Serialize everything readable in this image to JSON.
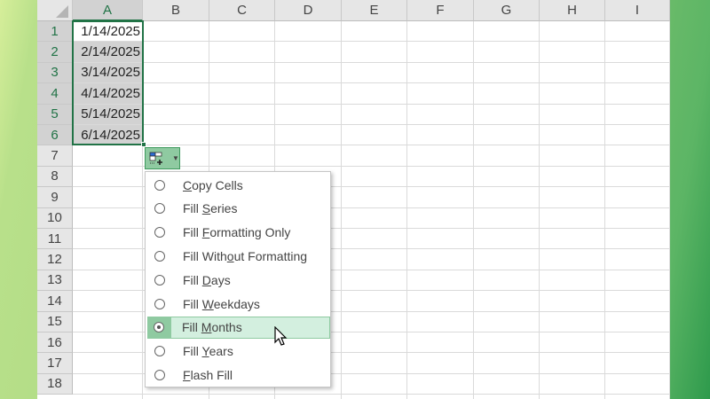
{
  "columns": [
    "A",
    "B",
    "C",
    "D",
    "E",
    "F",
    "G",
    "H",
    "I"
  ],
  "rows": [
    "1",
    "2",
    "3",
    "4",
    "5",
    "6",
    "7",
    "8",
    "9",
    "10",
    "11",
    "12",
    "13",
    "14",
    "15",
    "16",
    "17",
    "18"
  ],
  "cells_A": [
    "1/14/2025",
    "2/14/2025",
    "3/14/2025",
    "4/14/2025",
    "5/14/2025",
    "6/14/2025"
  ],
  "autofill_menu": {
    "selected": "Fill Months",
    "items": [
      {
        "pre": "",
        "key": "C",
        "post": "opy Cells"
      },
      {
        "pre": "Fill ",
        "key": "S",
        "post": "eries"
      },
      {
        "pre": "Fill ",
        "key": "F",
        "post": "ormatting Only"
      },
      {
        "pre": "Fill With",
        "key": "o",
        "post": "ut Formatting"
      },
      {
        "pre": "Fill ",
        "key": "D",
        "post": "ays"
      },
      {
        "pre": "Fill ",
        "key": "W",
        "post": "eekdays"
      },
      {
        "pre": "Fill ",
        "key": "M",
        "post": "onths"
      },
      {
        "pre": "Fill ",
        "key": "Y",
        "post": "ears"
      },
      {
        "pre": "",
        "key": "F",
        "post": "lash Fill"
      }
    ]
  },
  "colors": {
    "accent": "#217346",
    "highlight": "#d3efdf"
  }
}
